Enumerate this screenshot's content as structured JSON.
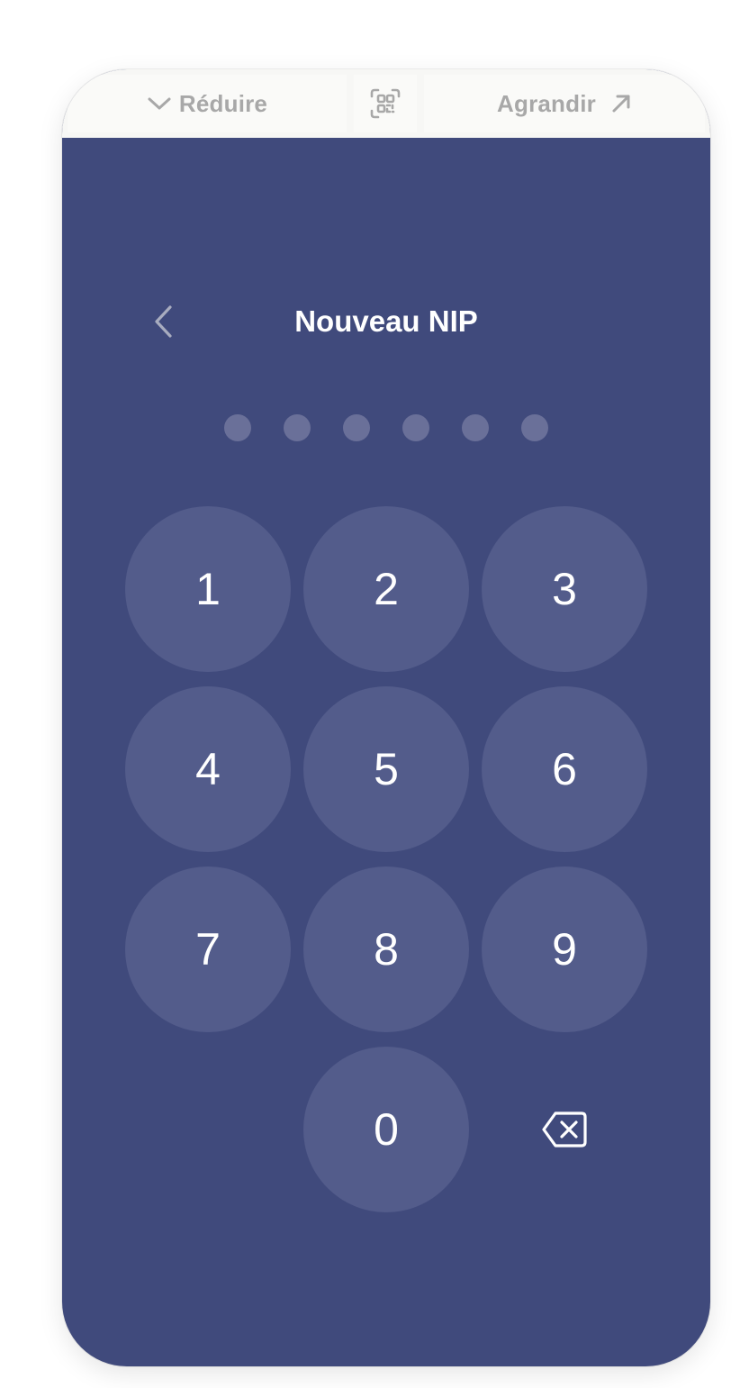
{
  "toolbar": {
    "reduce_label": "Réduire",
    "expand_label": "Agrandir",
    "reduce_icon": "chevron-down-icon",
    "qr_icon": "qr-code-icon",
    "expand_icon": "arrow-up-right-icon"
  },
  "screen": {
    "title": "Nouveau NIP",
    "back_icon": "chevron-left-icon",
    "pin_length": 6,
    "pin_filled": 0
  },
  "keypad": {
    "keys": [
      "1",
      "2",
      "3",
      "4",
      "5",
      "6",
      "7",
      "8",
      "9",
      "0"
    ],
    "delete_icon": "backspace-icon"
  },
  "colors": {
    "background": "#404a7c",
    "key": "#535c8b",
    "dot": "#6a7099",
    "toolbar": "#f7f7f5",
    "toolbar_text": "#a8a8a8"
  }
}
